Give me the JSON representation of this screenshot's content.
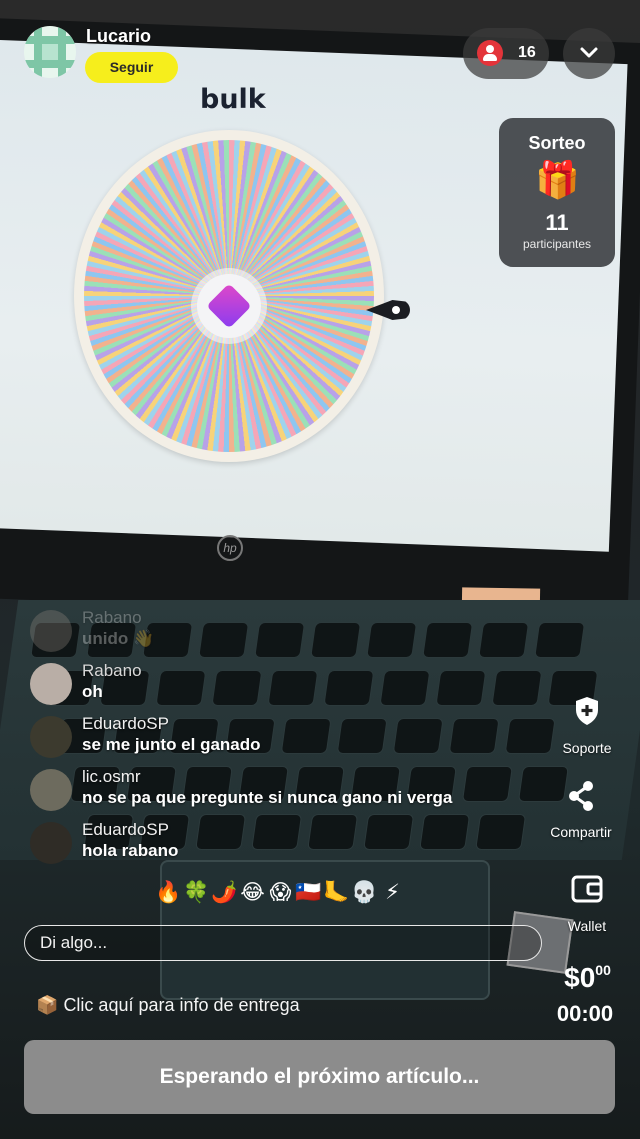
{
  "header": {
    "username": "Lucario",
    "follow_label": "Seguir",
    "viewer_count": "16"
  },
  "screen": {
    "title": "bulk"
  },
  "giveaway": {
    "title": "Sorteo",
    "gift_icon": "🎁",
    "count": "11",
    "label": "participantes"
  },
  "chat": {
    "messages": [
      {
        "name": "Rabano",
        "text": "unido 👋"
      },
      {
        "name": "Rabano",
        "text": "oh"
      },
      {
        "name": "EduardoSP",
        "text": "se me junto el ganado"
      },
      {
        "name": "lic.osmr",
        "text": "no se pa que pregunte si nunca gano ni verga"
      },
      {
        "name": "EduardoSP",
        "text": "hola rabano"
      }
    ]
  },
  "reactions": [
    "🔥",
    "🍀",
    "🌶️",
    "😂",
    "😱",
    "🇨🇱",
    "🦶",
    "💀",
    "⚡"
  ],
  "input": {
    "placeholder": "Di algo..."
  },
  "delivery": {
    "icon": "📦",
    "text": "Clic aquí para info de entrega"
  },
  "rail": {
    "support_label": "Soporte",
    "share_label": "Compartir",
    "wallet_label": "Wallet"
  },
  "price": {
    "main": "$0",
    "cents": "00",
    "timer": "00:00"
  },
  "action": {
    "waiting_label": "Esperando el próximo artículo..."
  },
  "colors": {
    "follow_button": "#f6ee1c",
    "viewer_badge": "#e3343a",
    "waiting_button": "#8c8c8c"
  }
}
